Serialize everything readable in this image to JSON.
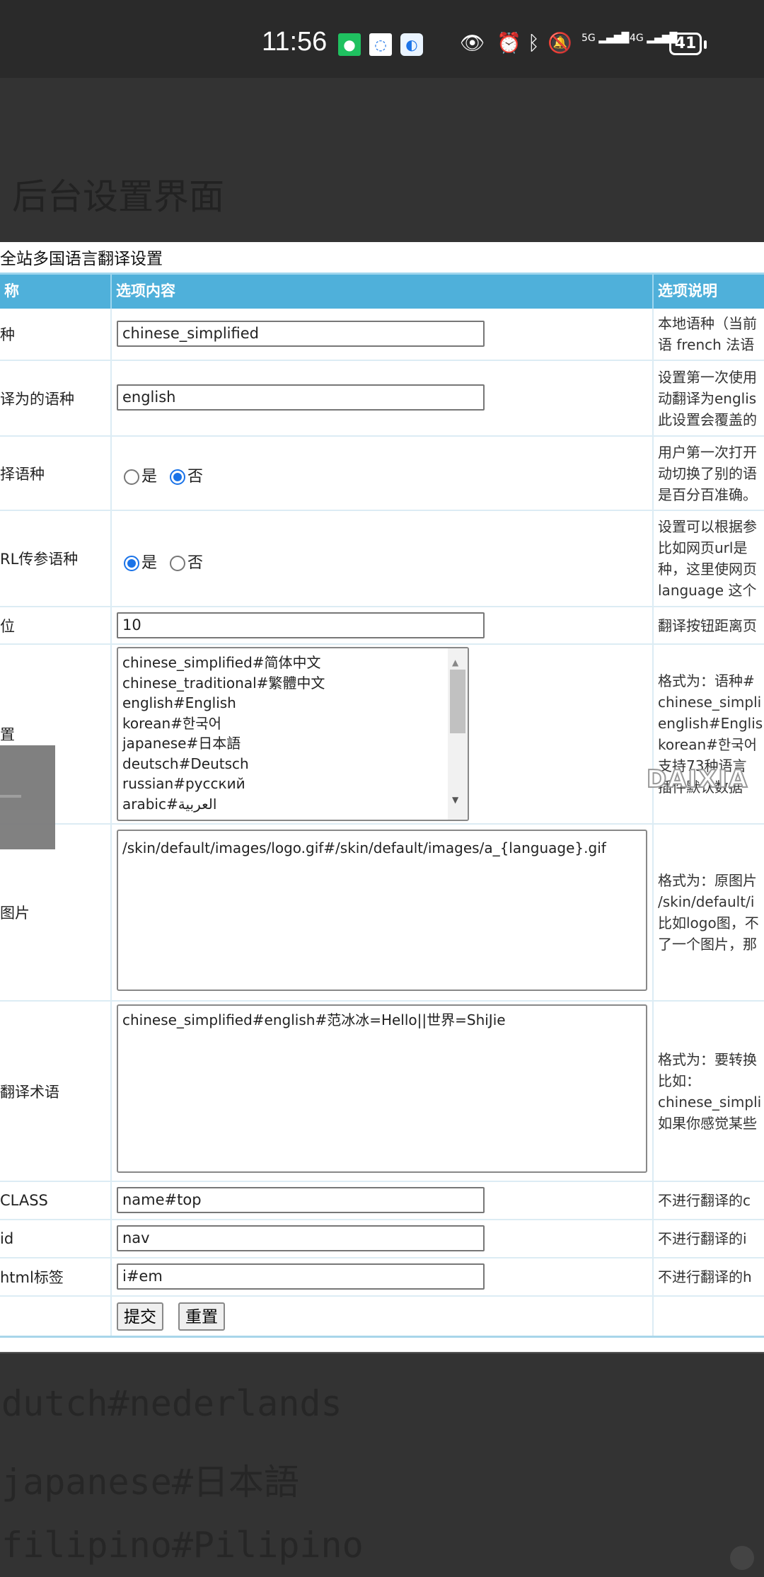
{
  "status_bar": {
    "time": "11:56",
    "battery": "41",
    "net1": "5G",
    "net2": "4G"
  },
  "page_title": "后台设置界面",
  "caption": "全站多国语言翻译设置",
  "headers": [
    "称",
    "选项内容",
    "选项说明"
  ],
  "rows": [
    {
      "label": "种",
      "value": "chinese_simplified",
      "desc": [
        "本地语种（当前",
        "语 french 法语"
      ]
    },
    {
      "label": "译为的语种",
      "value": "english",
      "desc": [
        "设置第一次使用",
        "动翻译为englis",
        "此设置会覆盖的"
      ]
    },
    {
      "label": "择语种",
      "radio_yes": "是",
      "radio_no": "否",
      "selected": "否",
      "desc": [
        "用户第一次打开",
        "动切换了别的语",
        "是百分百准确。"
      ]
    },
    {
      "label": "RL传参语种",
      "radio_yes": "是",
      "radio_no": "否",
      "selected": "是",
      "desc": [
        "设置可以根据参",
        "比如网页url是",
        "种，这里使网页",
        "language 这个"
      ]
    },
    {
      "label": "位",
      "value": "10",
      "desc": [
        "翻译按钮距离页"
      ]
    },
    {
      "label": "置",
      "lines": [
        "chinese_simplified#简体中文",
        "chinese_traditional#繁體中文",
        "english#English",
        "korean#한국어",
        "japanese#日本語",
        "deutsch#Deutsch",
        "russian#русский",
        "arabic#العربية"
      ],
      "desc": [
        "格式为：语种#",
        "chinese_simpli",
        "english#Englis",
        "korean#한국어",
        "支持73种语言",
        "插件默认数据"
      ]
    },
    {
      "label": "图片",
      "value": "/skin/default/images/logo.gif#/skin/default/images/a_{language}.gif",
      "desc": [
        "格式为：原图片",
        "/skin/default/i",
        "比如logo图，不",
        "了一个图片，那"
      ]
    },
    {
      "label": "翻译术语",
      "value": "chinese_simplified#english#范冰冰=Hello||世界=ShiJie",
      "desc": [
        "格式为：要转换",
        "比如：",
        "chinese_simpli",
        "如果你感觉某些"
      ]
    },
    {
      "label": "CLASS",
      "value": "name#top",
      "desc": [
        "不进行翻译的c"
      ]
    },
    {
      "label": "id",
      "value": "nav",
      "desc": [
        "不进行翻译的i"
      ]
    },
    {
      "label": "html标签",
      "value": "i#em",
      "desc": [
        "不进行翻译的h"
      ]
    }
  ],
  "buttons": {
    "submit": "提交",
    "reset": "重置"
  },
  "watermark": "DAIXIA",
  "bottom_lines": [
    "dutch#nederlands",
    "japanese#日本語",
    "filipino#Pilipino"
  ]
}
